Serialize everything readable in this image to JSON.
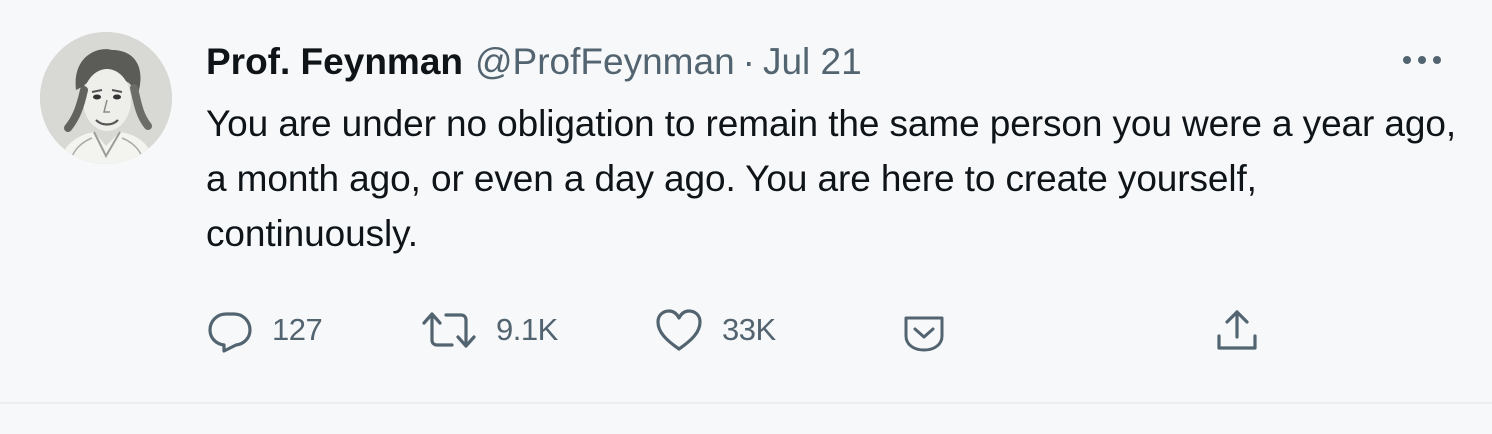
{
  "tweet": {
    "author": {
      "display_name": "Prof. Feynman",
      "handle": "@ProfFeynman"
    },
    "separator": "·",
    "date": "Jul 21",
    "text": "You are under no obligation to remain the same person you were a year ago, a month ago, or even a day ago. You are here to create yourself, continuously.",
    "actions": {
      "reply_count": "127",
      "retweet_count": "9.1K",
      "like_count": "33K"
    },
    "icons": {
      "reply": "reply-icon",
      "retweet": "retweet-icon",
      "like": "heart-icon",
      "tip": "tip-jar-icon",
      "share": "share-icon",
      "more": "more-options-icon"
    },
    "colors": {
      "background": "#f7f8f9",
      "primary_text": "#0f1419",
      "secondary_text": "#536471",
      "border": "#eceef0"
    }
  }
}
